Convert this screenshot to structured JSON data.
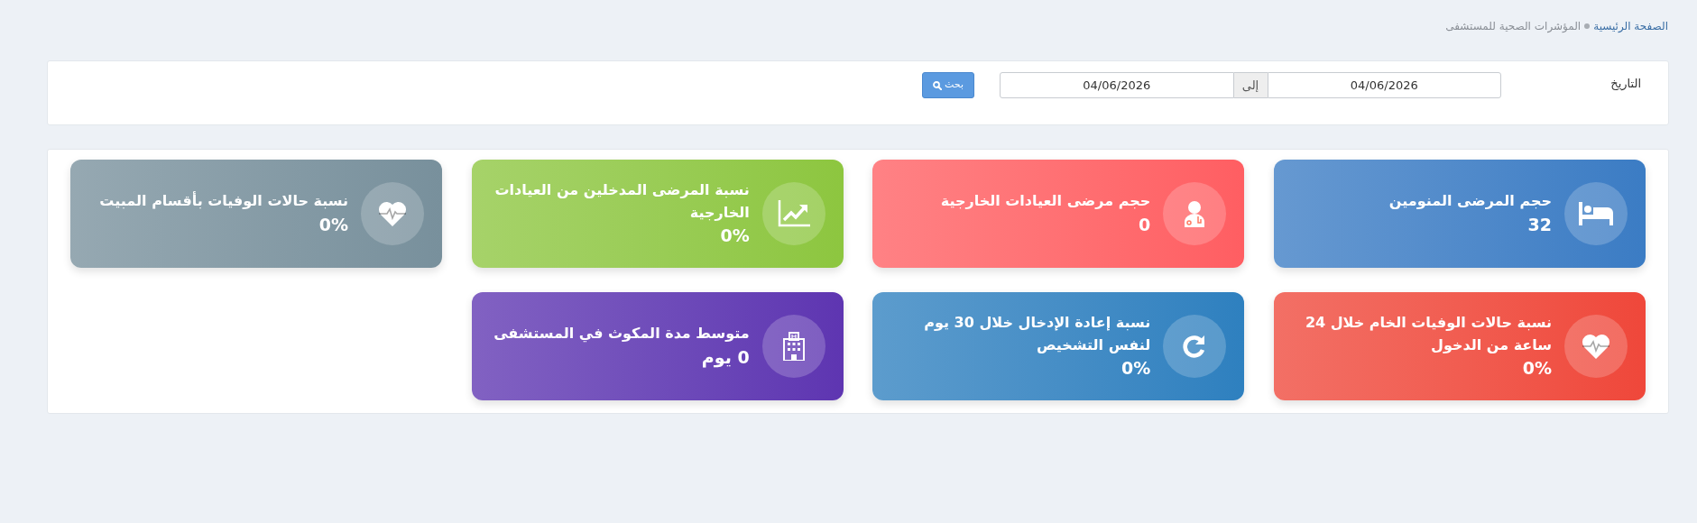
{
  "breadcrumb": [
    {
      "label": "الصفحة الرئيسية",
      "link": true
    },
    {
      "label": "المؤشرات الصحية للمستشفى",
      "link": false
    }
  ],
  "filter": {
    "label": "التاريخ",
    "from": "04/06/2026",
    "separator": "إلى",
    "to": "04/06/2026",
    "button": "بحث"
  },
  "cards": [
    {
      "title": "حجم المرضى المنومين",
      "value": "32",
      "kind": "bed",
      "color": "#3b7cc4"
    },
    {
      "title": "حجم مرضى العيادات الخارجية",
      "value": "0",
      "kind": "doctor",
      "color": "#ff5e62"
    },
    {
      "title": "نسبة المرضى المدخلين من العيادات الخارجية",
      "value": "0%",
      "kind": "chart",
      "color": "#8dc63f"
    },
    {
      "title": "نسبة حالات الوفيات بأقسام المبيت",
      "value": "0%",
      "kind": "heart",
      "color": "#78909c"
    },
    {
      "title": "نسبة حالات الوفيات الخام خلال 24 ساعة من الدخول",
      "value": "0%",
      "kind": "heart",
      "color": "#ef473a"
    },
    {
      "title": "نسبة إعادة الإدخال خلال 30 يوم لنفس التشخيص",
      "value": "0%",
      "kind": "refresh",
      "color": "#2e80bf"
    },
    {
      "title": "متوسط مدة المكوث في المستشفى",
      "value": "0 يوم",
      "kind": "hospital",
      "color": "#5e35b1"
    }
  ]
}
